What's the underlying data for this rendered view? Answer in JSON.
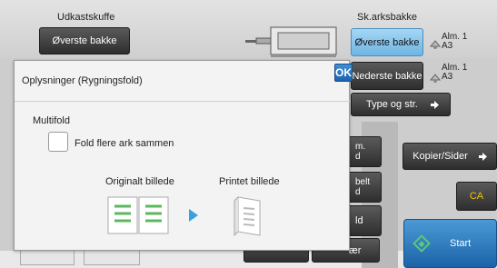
{
  "output_tray": {
    "label": "Udkastskuffe",
    "button_label": "Øverste bakke"
  },
  "paper_tray": {
    "label": "Sk.arksbakke",
    "upper": {
      "label": "Øverste bakke",
      "info_line1": "Alm. 1",
      "info_line2": "A3"
    },
    "lower": {
      "label": "Nederste bakke",
      "info_line1": "Alm. 1",
      "info_line2": "A3"
    },
    "type_button": "Type og str."
  },
  "right_buttons": {
    "kopier_sider": "Kopier/Sider",
    "ca": "CA",
    "start": "Start"
  },
  "hidden_buttons": {
    "b1_line1": "m.",
    "b1_line2": "d",
    "b2_line1": "belt",
    "b2_line2": "d",
    "b3": "ld",
    "b4": "ær"
  },
  "dialog": {
    "title": "Oplysninger (Rygningsfold)",
    "ok_label": "OK",
    "section_label": "Multifold",
    "checkbox_label": "Fold flere ark sammen",
    "checkbox_checked": false,
    "original_label": "Originalt billede",
    "printed_label": "Printet billede"
  },
  "colors": {
    "accent_blue": "#3a9fe0",
    "ok_blue": "#1b64ae",
    "start_blue": "#1c63a8",
    "ca_yellow": "#f2c200",
    "doc_green": "#5cb85c"
  }
}
